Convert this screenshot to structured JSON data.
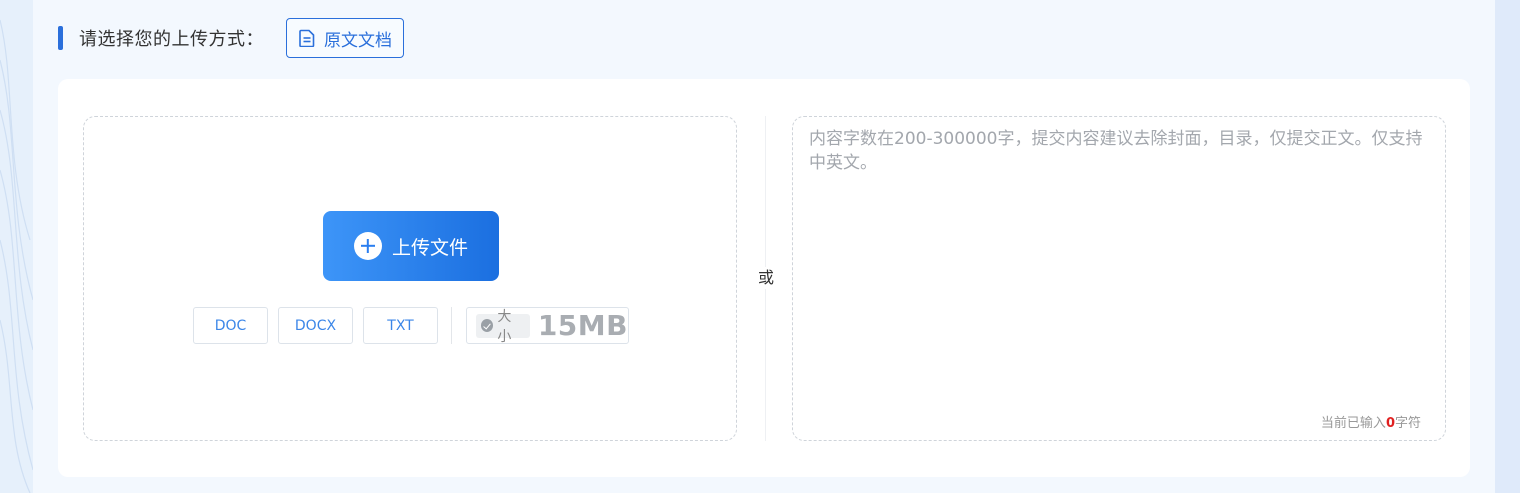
{
  "header": {
    "title": "请选择您的上传方式：",
    "mode_button_label": "原文文档"
  },
  "upload": {
    "button_label": "上传文件",
    "formats": [
      "DOC",
      "DOCX",
      "TXT"
    ],
    "size_label": "大小",
    "size_value": "15MB"
  },
  "divider_label": "或",
  "text_input": {
    "placeholder": "内容字数在200-300000字，提交内容建议去除封面，目录，仅提交正文。仅支持中英文。",
    "value": ""
  },
  "counter": {
    "prefix": "当前已输入",
    "count": "0",
    "suffix": "字符"
  },
  "colors": {
    "accent": "#2a6fdb",
    "upload_gradient_start": "#3d95f8",
    "upload_gradient_end": "#1b6fe0",
    "counter_number": "#e02020"
  }
}
